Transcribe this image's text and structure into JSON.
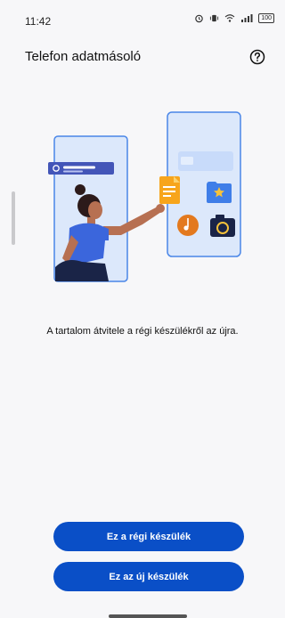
{
  "status_bar": {
    "time": "11:42",
    "battery": "100",
    "icons": [
      "alarm-icon",
      "vibrate-icon",
      "wifi-icon",
      "signal-icon",
      "battery-icon"
    ]
  },
  "header": {
    "title": "Telefon adatmásoló",
    "help_icon": "help-circle-icon"
  },
  "illustration": {
    "icons": [
      "document-icon",
      "folder-star-icon",
      "music-icon",
      "camera-icon"
    ]
  },
  "main": {
    "description": "A tartalom átvitele a régi készülékről az újra."
  },
  "buttons": {
    "old_device": "Ez a régi készülék",
    "new_device": "Ez az új készülék"
  },
  "colors": {
    "primary": "#0a4fc7",
    "background": "#f7f7f9",
    "phone_fill": "#dce8fb",
    "phone_border": "#4a86e8"
  }
}
